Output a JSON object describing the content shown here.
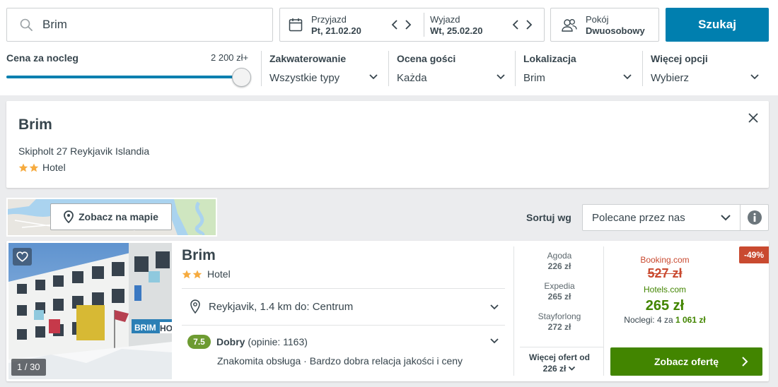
{
  "search": {
    "value": "Brim",
    "icon": "search-icon"
  },
  "dates": {
    "checkin_label": "Przyjazd",
    "checkin_value": "Pt, 21.02.20",
    "checkout_label": "Wyjazd",
    "checkout_value": "Wt, 25.02.20"
  },
  "room": {
    "label": "Pokój",
    "value": "Dwuosobowy"
  },
  "search_button": "Szukaj",
  "filters": {
    "price_label": "Cena za nocleg",
    "price_value": "2 200 zł+",
    "price_level": 1.0,
    "accommodation": {
      "title": "Zakwaterowanie",
      "value": "Wszystkie typy"
    },
    "rating": {
      "title": "Ocena gości",
      "value": "Każda"
    },
    "location": {
      "title": "Lokalizacja",
      "value": "Brim"
    },
    "more": {
      "title": "Więcej opcji",
      "value": "Wybierz"
    }
  },
  "info": {
    "title": "Brim",
    "address": "Skipholt 27 Reykjavik Islandia",
    "stars": 2,
    "type": "Hotel"
  },
  "map_button": "Zobacz na mapie",
  "sort": {
    "label": "Sortuj wg",
    "value": "Polecane przez nas"
  },
  "result": {
    "photo_count": "1 / 30",
    "name": "Brim",
    "stars": 2,
    "type": "Hotel",
    "location": "Reykjavik, 1.4 km do: Centrum",
    "rating_score": "7.5",
    "rating_label": "Dobry",
    "rating_count": "(opinie: 1163)",
    "features": "Znakomita obsługa · Bardzo dobra relacja jakości i ceny",
    "partners": [
      {
        "name": "Agoda",
        "price": "226 zł"
      },
      {
        "name": "Expedia",
        "price": "265 zł"
      },
      {
        "name": "Stayforlong",
        "price": "272 zł"
      }
    ],
    "more_offers_line1": "Więcej ofert od",
    "more_offers_line2": "226 zł",
    "deal": {
      "strike_site": "Booking.com",
      "strike_price": "527 zł",
      "site": "Hotels.com",
      "price": "265 zł",
      "nights_prefix": "Noclegi: 4 za",
      "nights_total": "1 061 zł",
      "discount": "-49%",
      "button": "Zobacz ofertę"
    }
  },
  "colors": {
    "primary": "#007faf",
    "deal_green": "#428500",
    "strike_red": "#c94a30",
    "star": "#f6ab3f",
    "rating_green": "#6d9b31"
  }
}
